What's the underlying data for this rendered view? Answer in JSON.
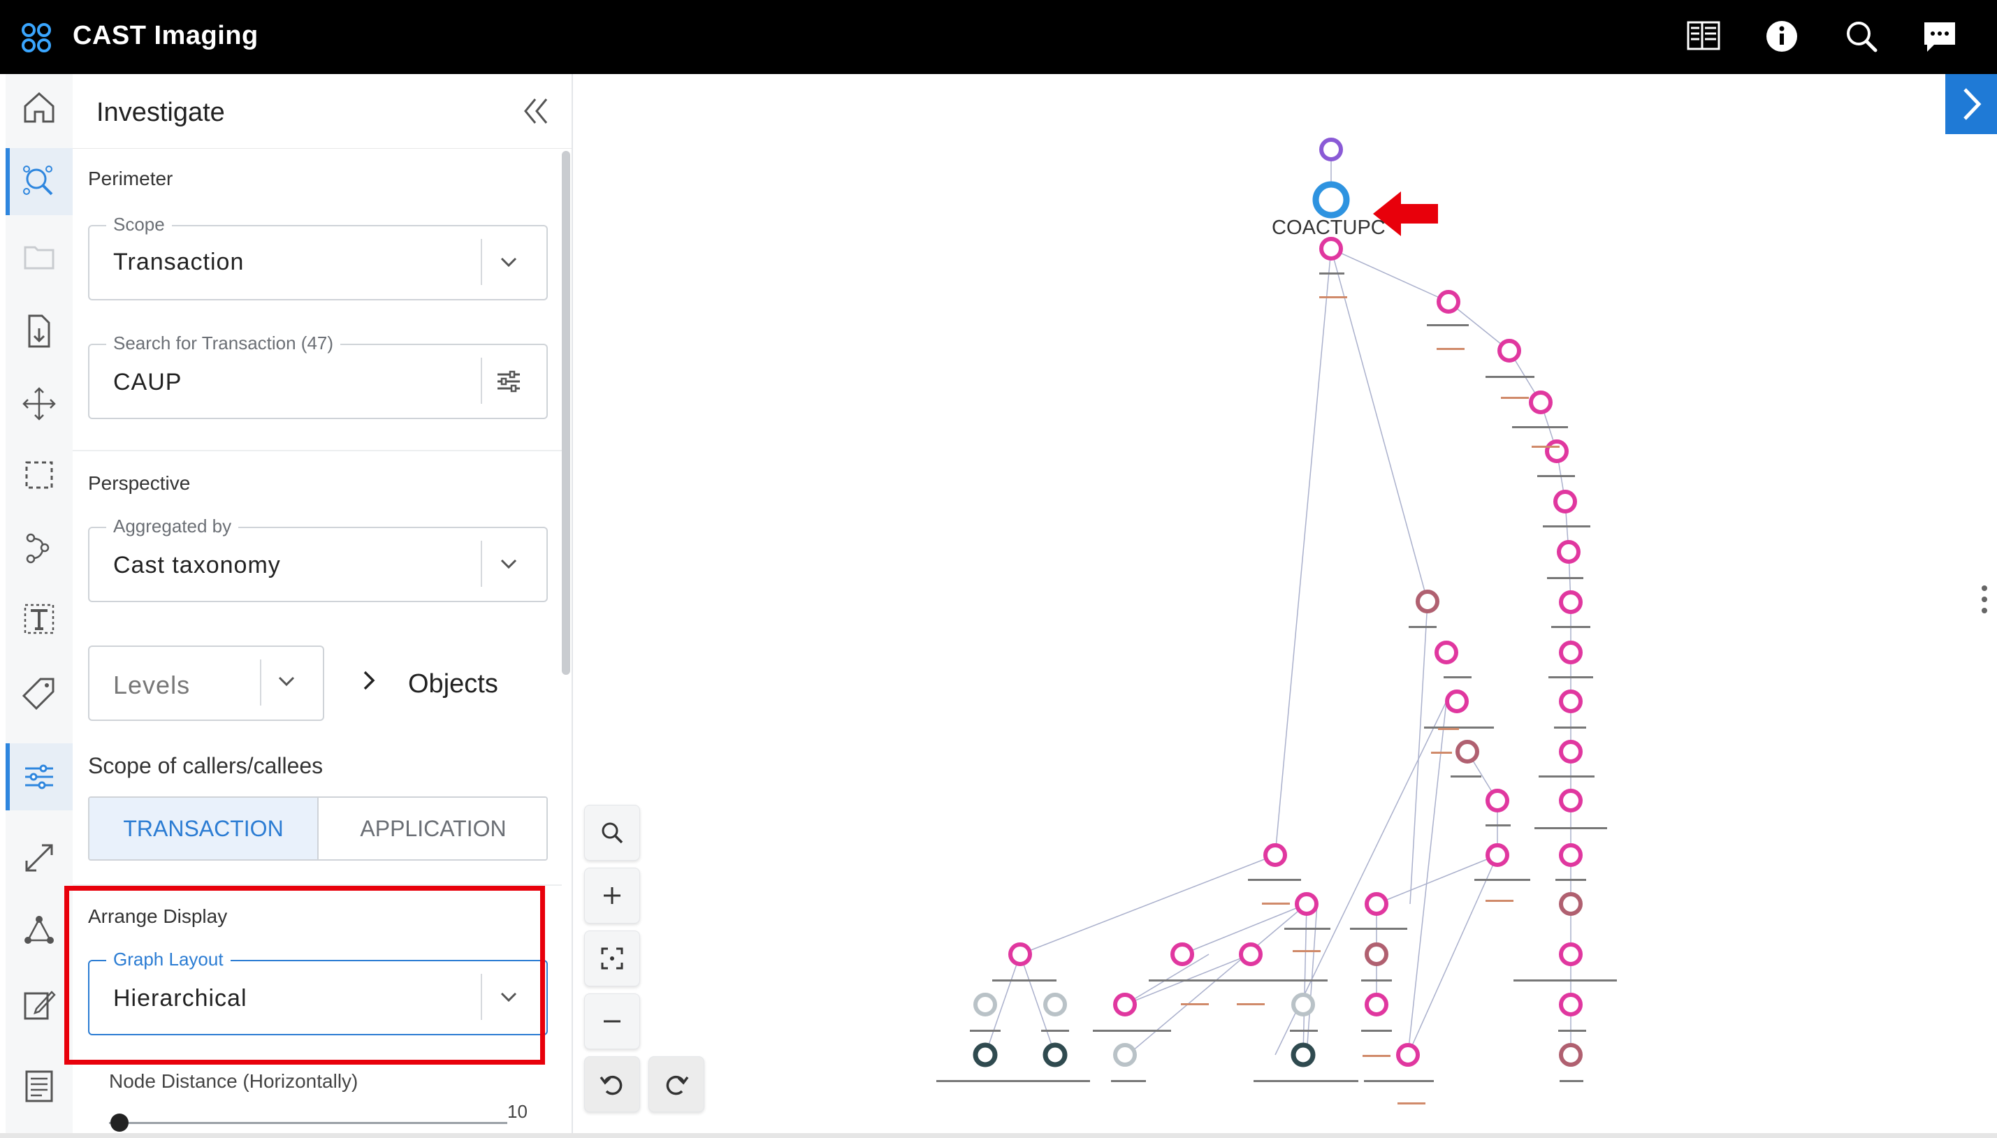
{
  "app": {
    "title": "CAST Imaging"
  },
  "topbar": {
    "icons": [
      "panel-view-icon",
      "info-icon",
      "search-icon",
      "chat-icon"
    ]
  },
  "rail": {
    "icons": [
      "home-icon",
      "investigate-icon",
      "folder-share-icon",
      "file-download-icon",
      "move-icon",
      "selection-icon",
      "path-icon",
      "text-icon",
      "tag-icon",
      "sliders-icon",
      "expand-icon",
      "graph-icon",
      "edit-icon",
      "notes-icon"
    ]
  },
  "panel": {
    "title": "Investigate",
    "perimeter": {
      "label": "Perimeter",
      "scope_legend": "Scope",
      "scope_value": "Transaction",
      "search_legend": "Search for Transaction (47)",
      "search_value": "CAUP"
    },
    "perspective": {
      "label": "Perspective",
      "aggregated_legend": "Aggregated by",
      "aggregated_value": "Cast taxonomy",
      "levels_placeholder": "Levels",
      "objects_label": "Objects"
    },
    "callers": {
      "label": "Scope of callers/callees",
      "options": [
        "TRANSACTION",
        "APPLICATION"
      ],
      "selected": "TRANSACTION"
    },
    "arrange": {
      "label": "Arrange Display",
      "layout_legend": "Graph Layout",
      "layout_value": "Hierarchical",
      "node_distance_label": "Node Distance (Horizontally)",
      "node_distance_max": "10",
      "node_distance_value": 0
    }
  },
  "graph": {
    "root_label": "COACTUPC",
    "colors": {
      "accent": "#1f7ad6",
      "node_pink": "#e0379f",
      "node_rose": "#b06070",
      "node_gray": "#b9c2c7",
      "node_dark": "#2f4a4f",
      "node_purple": "#8a5ad6",
      "node_blue": "#2e93e0",
      "highlight": "#e8000b"
    }
  }
}
